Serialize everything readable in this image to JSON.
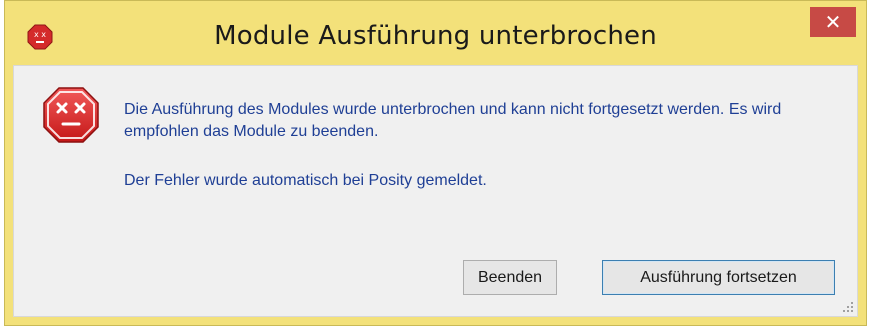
{
  "window": {
    "title": "Module Ausführung unterbrochen",
    "close_label": "✕",
    "accent_color": "#f3e17a",
    "close_color": "#c74a45"
  },
  "icons": {
    "app": "error-face-icon",
    "message": "error-stop-sign-icon"
  },
  "message": {
    "primary": "Die Ausführung des Modules wurde unterbrochen und kann nicht fortgesetzt werden. Es wird empfohlen das Module zu beenden.",
    "secondary": "Der Fehler wurde automatisch bei Posity gemeldet.",
    "text_color": "#1f3f95"
  },
  "buttons": {
    "quit_label": "Beenden",
    "continue_label": "Ausführung fortsetzen"
  }
}
